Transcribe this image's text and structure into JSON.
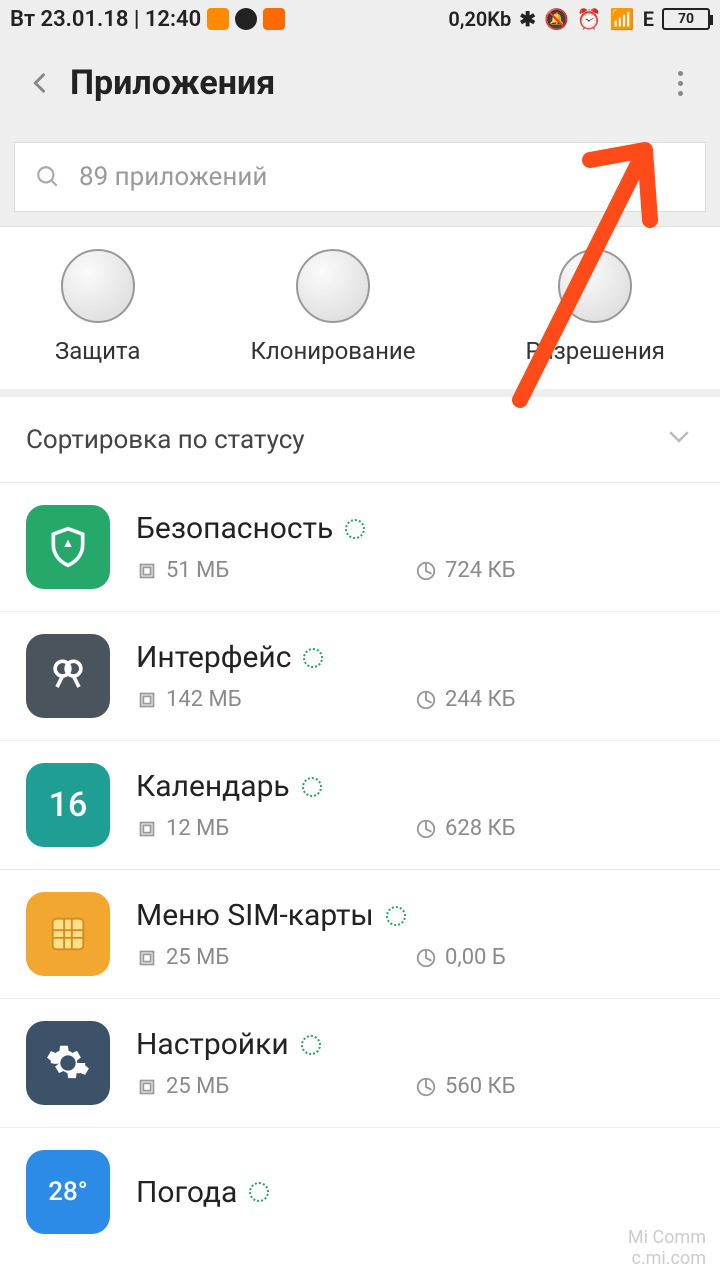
{
  "status": {
    "date_time": "Вт 23.01.18 | 12:40",
    "data": "0,20Kb",
    "network": "E",
    "battery": "70"
  },
  "header": {
    "title": "Приложения"
  },
  "search": {
    "placeholder": "89 приложений"
  },
  "actions": [
    {
      "label": "Защита"
    },
    {
      "label": "Клонирование"
    },
    {
      "label": "Разрешения"
    }
  ],
  "sort": {
    "label": "Сортировка по статусу"
  },
  "apps": [
    {
      "name": "Безопасность",
      "storage": "51 МБ",
      "data": "724 КБ",
      "icon": "security"
    },
    {
      "name": "Интерфейс",
      "storage": "142 МБ",
      "data": "244 КБ",
      "icon": "interface"
    },
    {
      "name": "Календарь",
      "storage": "12 МБ",
      "data": "628 КБ",
      "icon": "calendar"
    },
    {
      "name": "Меню SIM-карты",
      "storage": "25 МБ",
      "data": "0,00 Б",
      "icon": "sim"
    },
    {
      "name": "Настройки",
      "storage": "25 МБ",
      "data": "560 КБ",
      "icon": "settings"
    },
    {
      "name": "Погода",
      "storage": "",
      "data": "",
      "icon": "weather"
    }
  ],
  "watermark": {
    "line1": "Mi Comm",
    "line2": "c.mi.com"
  }
}
